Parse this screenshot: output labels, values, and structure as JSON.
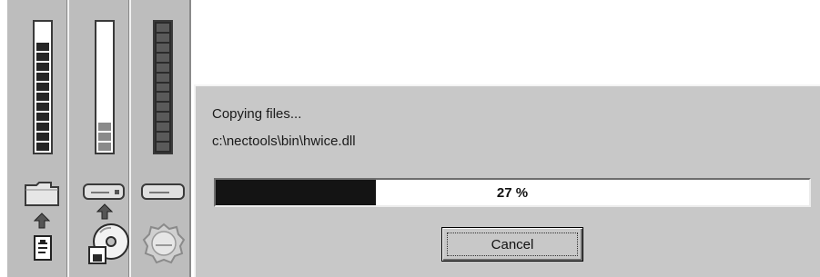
{
  "meters": [
    {
      "name": "folder-meter",
      "filled": 11,
      "total": 13
    },
    {
      "name": "disk-meter",
      "filled": 3,
      "total": 13
    },
    {
      "name": "memory-meter",
      "filled": 13,
      "total": 13
    }
  ],
  "icons": [
    "folder-icon",
    "up-arrow-icon",
    "file-icon",
    "drive-icon",
    "up-arrow-icon",
    "cd-icon",
    "drive-icon",
    "lion-logo-icon"
  ],
  "dialog": {
    "status": "Copying files...",
    "file_path": "c:\\nectools\\bin\\hwice.dll",
    "progress_percent": 27,
    "progress_label": "27 %",
    "cancel_label": "Cancel"
  },
  "colors": {
    "dialog_bg": "#c8c8c8",
    "progress_fill": "#141414",
    "panel_bg": "#bdbdbd"
  }
}
